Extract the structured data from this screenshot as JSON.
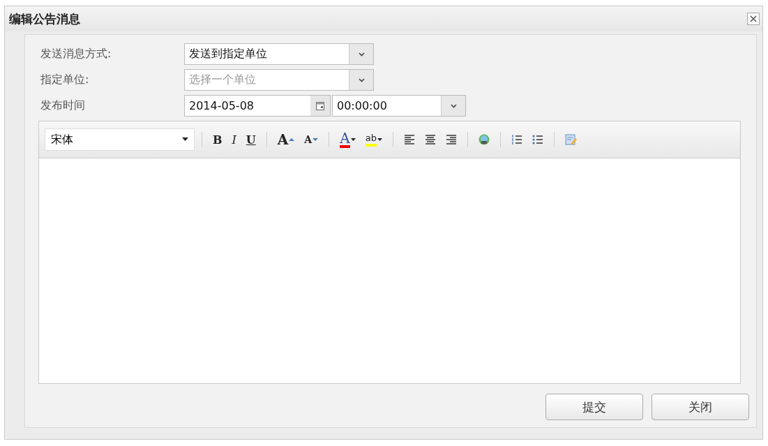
{
  "window": {
    "title": "编辑公告消息"
  },
  "form": [
    {
      "kind": "select",
      "label": "发送消息方式:",
      "value": "发送到指定单位"
    },
    {
      "kind": "select",
      "label": "指定单位:",
      "placeholder": "选择一个单位"
    },
    {
      "kind": "datetime",
      "label": "发布时间",
      "date": "2014-05-08",
      "time": "00:00:00"
    }
  ],
  "editor": {
    "font": "宋体",
    "tool_groups": [
      [
        {
          "kind": "bold",
          "label": "B"
        },
        {
          "kind": "italic",
          "label": "I"
        },
        {
          "kind": "underline",
          "label": "U"
        }
      ],
      [
        {
          "kind": "grow",
          "label": "A"
        },
        {
          "kind": "shrink",
          "label": "A"
        }
      ],
      [
        {
          "kind": "fontcolor",
          "label": "A"
        },
        {
          "kind": "highlight",
          "label": "ab"
        }
      ],
      [
        {
          "kind": "alignleft"
        },
        {
          "kind": "aligncenter"
        },
        {
          "kind": "alignright"
        }
      ],
      [
        {
          "kind": "image"
        }
      ],
      [
        {
          "kind": "orderedlist"
        },
        {
          "kind": "unorderedlist"
        }
      ],
      [
        {
          "kind": "source"
        }
      ]
    ]
  },
  "buttons": [
    "提交",
    "关闭"
  ]
}
